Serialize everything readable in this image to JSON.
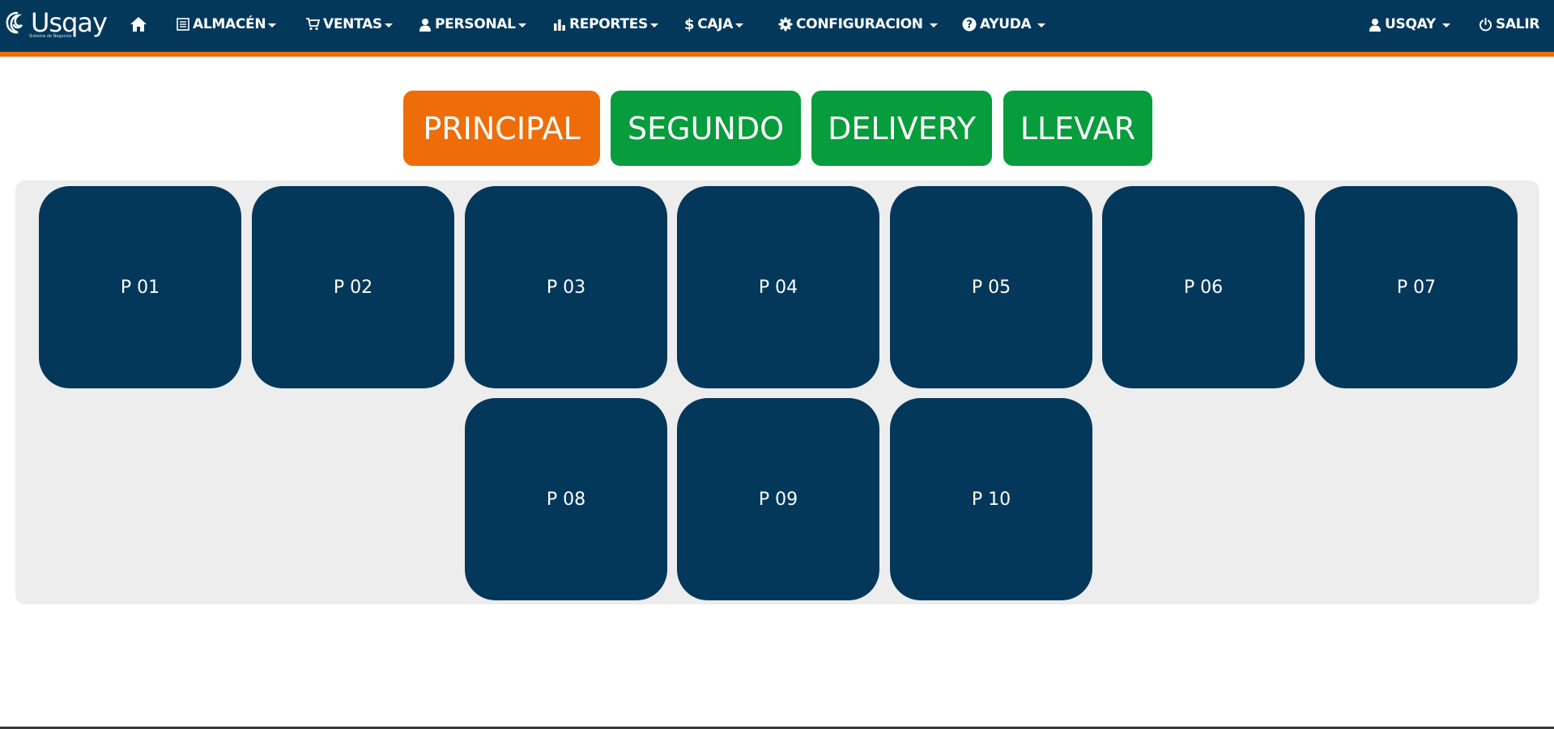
{
  "brand": {
    "name": "Usqay",
    "subtitle": "Sistema de Negocios"
  },
  "nav": {
    "home_icon": "home-icon",
    "items": [
      {
        "label": "ALMACÉN",
        "icon": "list-icon"
      },
      {
        "label": "VENTAS",
        "icon": "cart-icon"
      },
      {
        "label": "PERSONAL",
        "icon": "user-icon"
      },
      {
        "label": "REPORTES",
        "icon": "bar-chart-icon"
      },
      {
        "label": "CAJA",
        "icon": "dollar-icon"
      },
      {
        "label": "CONFIGURACION",
        "icon": "gear-icon"
      },
      {
        "label": "AYUDA",
        "icon": "question-icon"
      }
    ],
    "user": {
      "label": "USQAY",
      "icon": "user-icon"
    },
    "logout": {
      "label": "SALIR",
      "icon": "power-icon"
    }
  },
  "tabs": [
    {
      "label": "PRINCIPAL",
      "active": true
    },
    {
      "label": "SEGUNDO",
      "active": false
    },
    {
      "label": "DELIVERY",
      "active": false
    },
    {
      "label": "LLEVAR",
      "active": false
    }
  ],
  "tables": [
    "P 01",
    "P 02",
    "P 03",
    "P 04",
    "P 05",
    "P 06",
    "P 07",
    "P 08",
    "P 09",
    "P 10"
  ],
  "colors": {
    "navbar": "#03385b",
    "accent": "#ee6d09",
    "tab_active": "#ee6d09",
    "tab_inactive": "#079c3c",
    "table": "#03385b",
    "panel": "#ededed"
  }
}
